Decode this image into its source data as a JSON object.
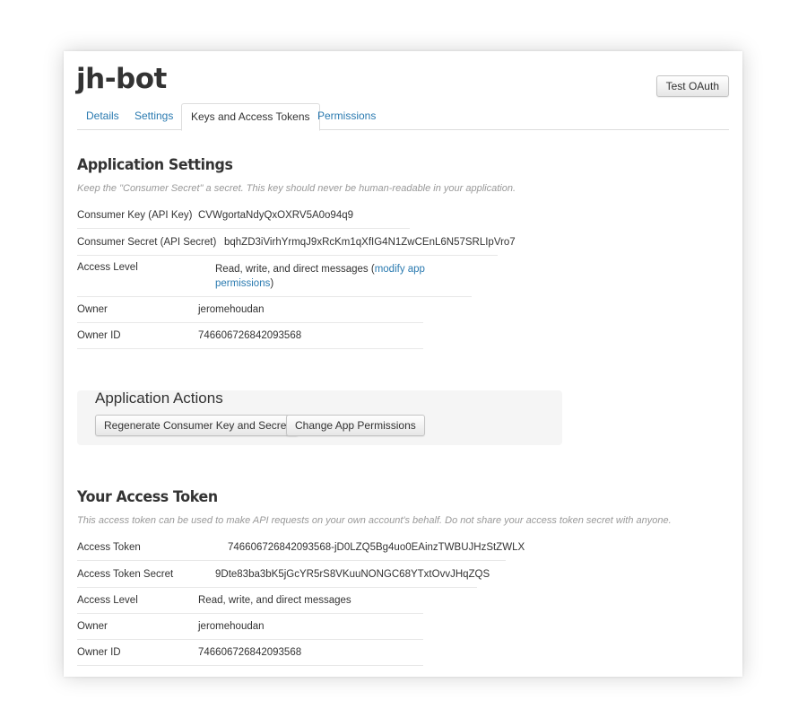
{
  "app": {
    "title": "jh-bot",
    "test_oauth_label": "Test OAuth"
  },
  "tabs": [
    {
      "label": "Details",
      "active": false
    },
    {
      "label": "Settings",
      "active": false
    },
    {
      "label": "Keys and Access Tokens",
      "active": true
    },
    {
      "label": "Permissions",
      "active": false
    }
  ],
  "application_settings": {
    "title": "Application Settings",
    "hint": "Keep the \"Consumer Secret\" a secret. This key should never be human-readable in your application.",
    "consumer_key": {
      "label": "Consumer Key (API Key)",
      "value": "CVWgortaNdyQxOXRV5A0o94q9"
    },
    "consumer_secret": {
      "label": "Consumer Secret (API Secret)",
      "value": "bqhZD3iVirhYrmqJ9xRcKm1qXfIG4N1ZwCEnL6N57SRLIpVro7"
    },
    "access_level": {
      "label": "Access Level",
      "value_prefix": "Read, write, and direct messages (",
      "link_text": "modify app permissions",
      "value_suffix": ")"
    },
    "owner": {
      "label": "Owner",
      "value": "jeromehoudan"
    },
    "owner_id": {
      "label": "Owner ID",
      "value": "746606726842093568"
    }
  },
  "application_actions": {
    "title": "Application Actions",
    "regenerate_label": "Regenerate Consumer Key and Secret",
    "change_permissions_label": "Change App Permissions"
  },
  "access_token": {
    "title": "Your Access Token",
    "hint": "This access token can be used to make API requests on your own account's behalf. Do not share your access token secret with anyone.",
    "token": {
      "label": "Access Token",
      "value": "746606726842093568-jD0LZQ5Bg4uo0EAinzTWBUJHzStZWLX"
    },
    "token_secret": {
      "label": "Access Token Secret",
      "value": "9Dte83ba3bK5jGcYR5rS8VKuuNONGC68YTxtOvvJHqZQS"
    },
    "access_level": {
      "label": "Access Level",
      "value": "Read, write, and direct messages"
    },
    "owner": {
      "label": "Owner",
      "value": "jeromehoudan"
    },
    "owner_id": {
      "label": "Owner ID",
      "value": "746606726842093568"
    }
  }
}
